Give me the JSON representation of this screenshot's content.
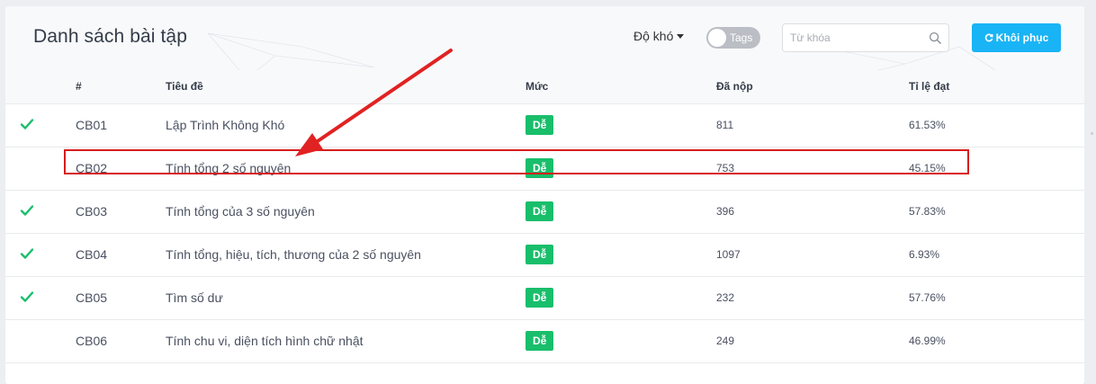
{
  "header": {
    "title": "Danh sách bài tập",
    "difficulty_label": "Độ khó",
    "tags_toggle_label": "Tags",
    "search_placeholder": "Từ khóa",
    "reset_label": "Khôi phục"
  },
  "colors": {
    "accent": "#19b4f5",
    "badge_green": "#19be6b",
    "check_green": "#19be6b",
    "annotation_red": "#d71d1d"
  },
  "table": {
    "columns": [
      "#",
      "Tiêu đề",
      "Mức",
      "Đã nộp",
      "Tỉ lệ đạt"
    ],
    "rows": [
      {
        "solved": true,
        "code": "CB01",
        "title": "Lập Trình Không Khó",
        "level": "Dễ",
        "submissions": "811",
        "rate": "61.53%"
      },
      {
        "solved": false,
        "code": "CB02",
        "title": "Tính tổng 2 số nguyên",
        "level": "Dễ",
        "submissions": "753",
        "rate": "45.15%"
      },
      {
        "solved": true,
        "code": "CB03",
        "title": "Tính tổng của 3 số nguyên",
        "level": "Dễ",
        "submissions": "396",
        "rate": "57.83%"
      },
      {
        "solved": true,
        "code": "CB04",
        "title": "Tính tổng, hiệu, tích, thương của 2 số nguyên",
        "level": "Dễ",
        "submissions": "1097",
        "rate": "6.93%"
      },
      {
        "solved": true,
        "code": "CB05",
        "title": "Tìm số dư",
        "level": "Dễ",
        "submissions": "232",
        "rate": "57.76%"
      },
      {
        "solved": false,
        "code": "CB06",
        "title": "Tính chu vi, diện tích hình chữ nhật",
        "level": "Dễ",
        "submissions": "249",
        "rate": "46.99%"
      }
    ]
  },
  "annotation": {
    "highlighted_row": "CB02",
    "icons": [
      "red-arrow-icon"
    ]
  }
}
